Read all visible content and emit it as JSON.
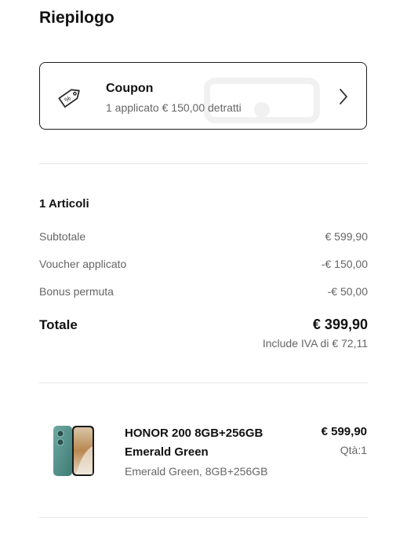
{
  "summary": {
    "title": "Riepilogo"
  },
  "coupon": {
    "title": "Coupon",
    "subtitle": "1 applicato € 150,00 detratti",
    "icon": "coupon-tag-icon",
    "chevron_icon": "chevron-right-icon"
  },
  "order": {
    "items_count_label": "1 Articoli",
    "rows": [
      {
        "label": "Subtotale",
        "value": "€ 599,90"
      },
      {
        "label": "Voucher applicato",
        "value": "-€ 150,00"
      },
      {
        "label": "Bonus permuta",
        "value": "-€ 50,00"
      }
    ],
    "total_label": "Totale",
    "total_value": "€ 399,90",
    "vat_note": "Include IVA di € 72,11"
  },
  "product": {
    "name": "HONOR 200 8GB+256GB Emerald Green",
    "variant": "Emerald Green, 8GB+256GB",
    "price": "€ 599,90",
    "quantity": "Qtà:1",
    "image_color": "#4f8f88"
  }
}
